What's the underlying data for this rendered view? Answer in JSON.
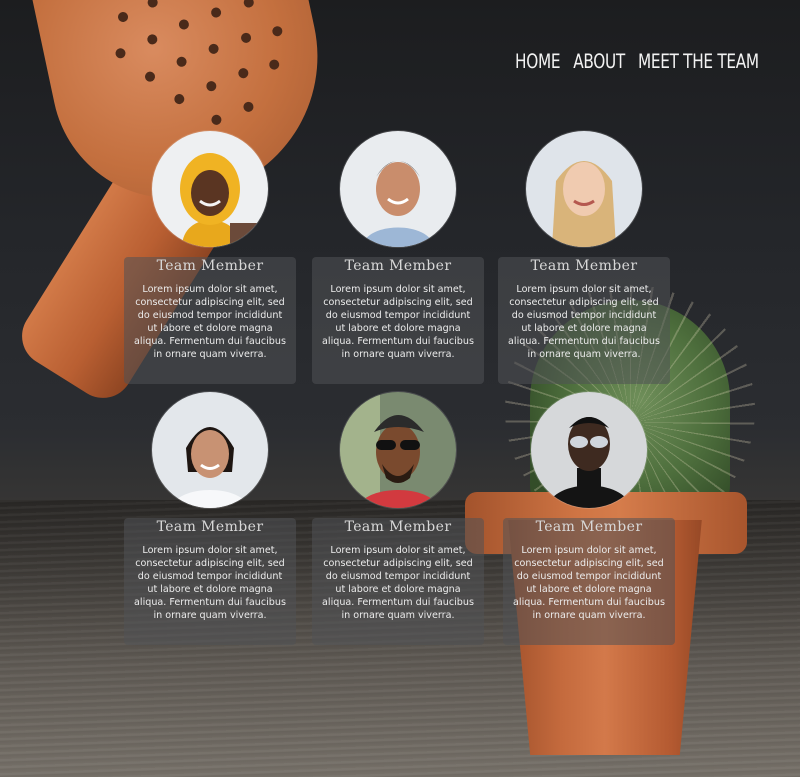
{
  "nav": {
    "home": "HOME",
    "about": "ABOUT",
    "team": "MEET THE TEAM"
  },
  "members": [
    {
      "title": "Team Member",
      "text": "Lorem ipsum dolor sit amet, consectetur adipiscing elit, sed do eiusmod tempor incididunt ut labore et dolore magna aliqua. Fermentum dui faucibus in ornare quam viverra."
    },
    {
      "title": "Team Member",
      "text": "Lorem ipsum dolor sit amet, consectetur adipiscing elit, sed do eiusmod tempor incididunt ut labore et dolore magna aliqua. Fermentum dui faucibus in ornare quam viverra."
    },
    {
      "title": "Team Member",
      "text": "Lorem ipsum dolor sit amet, consectetur adipiscing elit, sed do eiusmod tempor incididunt ut labore et dolore magna aliqua. Fermentum dui faucibus in ornare quam viverra."
    },
    {
      "title": "Team Member",
      "text": "Lorem ipsum dolor sit amet, consectetur adipiscing elit, sed do eiusmod tempor incididunt ut labore et dolore magna aliqua. Fermentum dui faucibus in ornare quam viverra."
    },
    {
      "title": "Team Member",
      "text": "Lorem ipsum dolor sit amet, consectetur adipiscing elit, sed do eiusmod tempor incididunt ut labore et dolore magna aliqua. Fermentum dui faucibus in ornare quam viverra."
    },
    {
      "title": "Team Member",
      "text": "Lorem ipsum dolor sit amet, consectetur adipiscing elit, sed do eiusmod tempor incididunt ut labore et dolore magna aliqua. Fermentum dui faucibus in ornare quam viverra."
    }
  ],
  "colors": {
    "card_bg": "rgba(80,82,86,0.55)",
    "nav_text": "#f2f2f2",
    "terracotta": "#c46a3d"
  }
}
